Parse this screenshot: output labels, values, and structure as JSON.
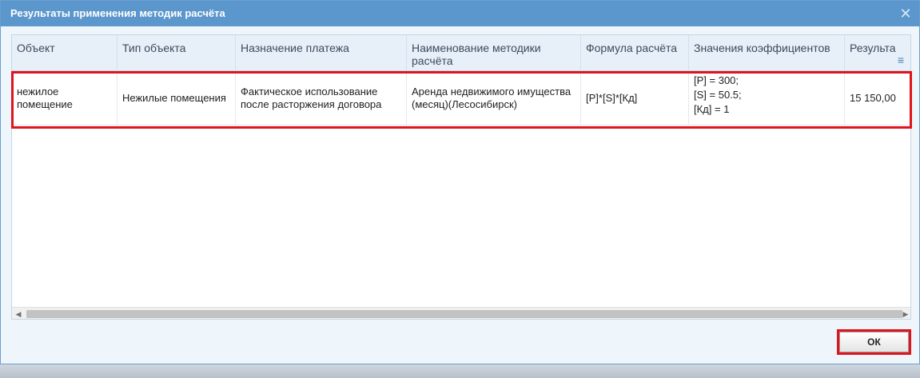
{
  "dialog": {
    "title": "Результаты применения методик расчёта",
    "close_glyph": "✕"
  },
  "grid": {
    "columns": [
      "Объект",
      "Тип объекта",
      "Назначение платежа",
      "Наименование методики расчёта",
      "Формула расчёта",
      "Значения коэффициентов",
      "Результа"
    ],
    "rows": [
      {
        "object": "нежилое помещение",
        "object_type": "Нежилые помещения",
        "payment_purpose": "Фактическое использование после расторжения договора",
        "method_name": "Аренда недвижимого имущества (месяц)(Лесосибирск)",
        "formula": "[P]*[S]*[Кд]",
        "coef_1": "[P] = 300;",
        "coef_2": "[S] = 50.5;",
        "coef_3": "[Кд] = 1",
        "result": "15 150,00"
      }
    ]
  },
  "icons": {
    "column_menu": "columns-menu-icon",
    "close": "close-icon",
    "scroll_left": "arrow-left-icon",
    "scroll_right": "arrow-right-icon"
  },
  "footer": {
    "ok_label": "ОК"
  },
  "colors": {
    "titlebar": "#5b97cc",
    "highlight": "#e0141e"
  }
}
